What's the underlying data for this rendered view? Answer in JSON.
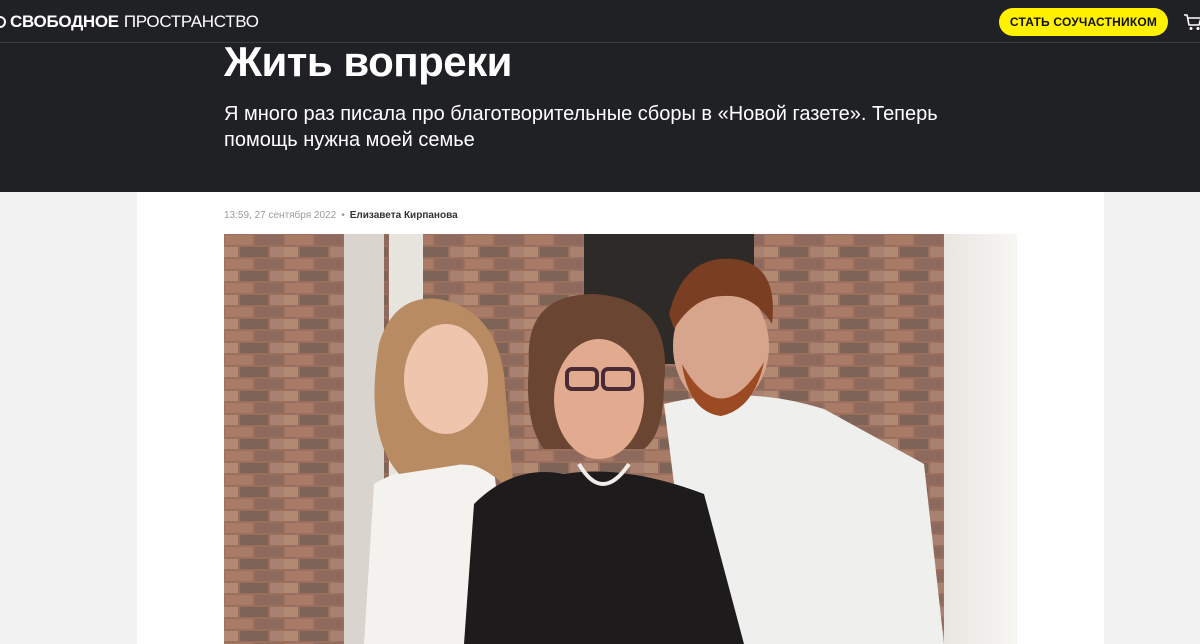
{
  "header": {
    "logo_bold": "СВОБОДНОЕ",
    "logo_light": "ПРОСТРАНСТВО",
    "support_button": "СТАТЬ СОУЧАСТНИКОМ",
    "cart_icon": "cart-icon",
    "accent_color": "#fff100",
    "background_color": "#202124"
  },
  "article": {
    "title": "Жить вопреки",
    "lead": "Я много раз писала про благотворительные сборы в «Новой газете». Теперь помощь нужна моей семье",
    "timestamp": "13:59, 27 сентября 2022",
    "separator": "•",
    "author": "Елизавета Кирпанова"
  }
}
